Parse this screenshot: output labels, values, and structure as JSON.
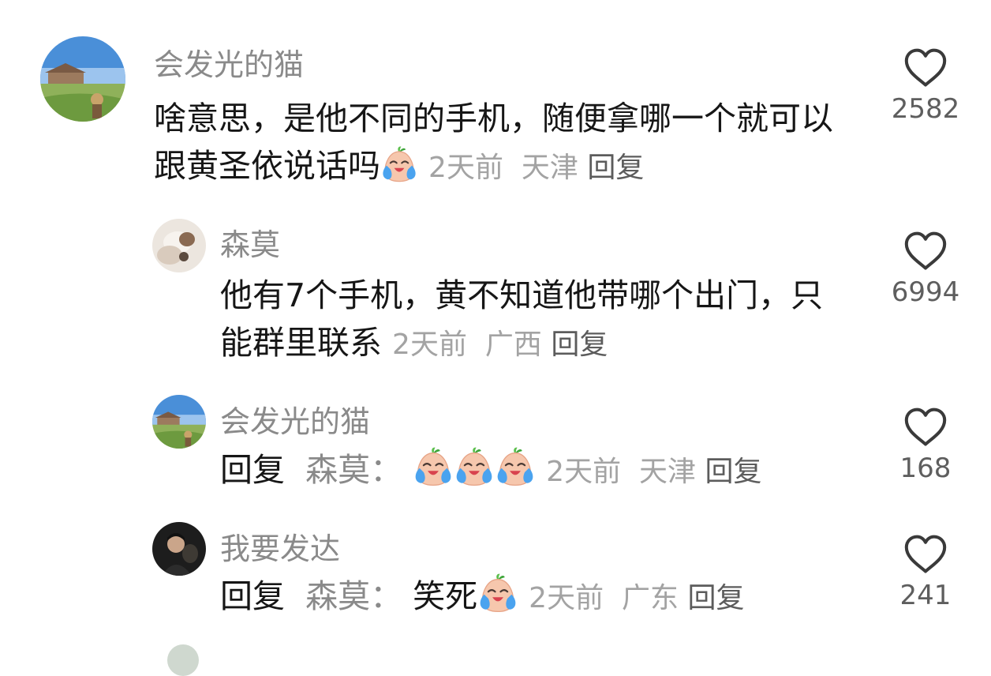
{
  "comments": [
    {
      "author": "会发光的猫",
      "text": "啥意思，是他不同的手机，随便拿哪一个就可以跟黄圣依说话吗",
      "emoji": "crying-laughing-emoji",
      "time": "2天前",
      "location": "天津",
      "reply_label": "回复",
      "likes": "2582"
    },
    {
      "author": "森莫",
      "text": "他有7个手机，黄不知道他带哪个出门，只能群里联系",
      "time": "2天前",
      "location": "广西",
      "reply_label": "回复",
      "likes": "6994"
    },
    {
      "author": "会发光的猫",
      "reply_prefix": "回复",
      "reply_to": "森莫：",
      "emojis": [
        "crying-laughing-emoji",
        "crying-laughing-emoji",
        "crying-laughing-emoji"
      ],
      "time": "2天前",
      "location": "天津",
      "reply_label": "回复",
      "likes": "168"
    },
    {
      "author": "我要发达",
      "reply_prefix": "回复",
      "reply_to": "森莫：",
      "text": "笑死",
      "emoji": "crying-laughing-emoji",
      "time": "2天前",
      "location": "广东",
      "reply_label": "回复",
      "likes": "241"
    }
  ],
  "icons": {
    "like": "heart-outline-icon"
  },
  "colors": {
    "text": "#161616",
    "name": "#8a8a8a",
    "meta": "#a3a3a3",
    "reply": "#5c5c5c",
    "count": "#5e5e5e"
  }
}
